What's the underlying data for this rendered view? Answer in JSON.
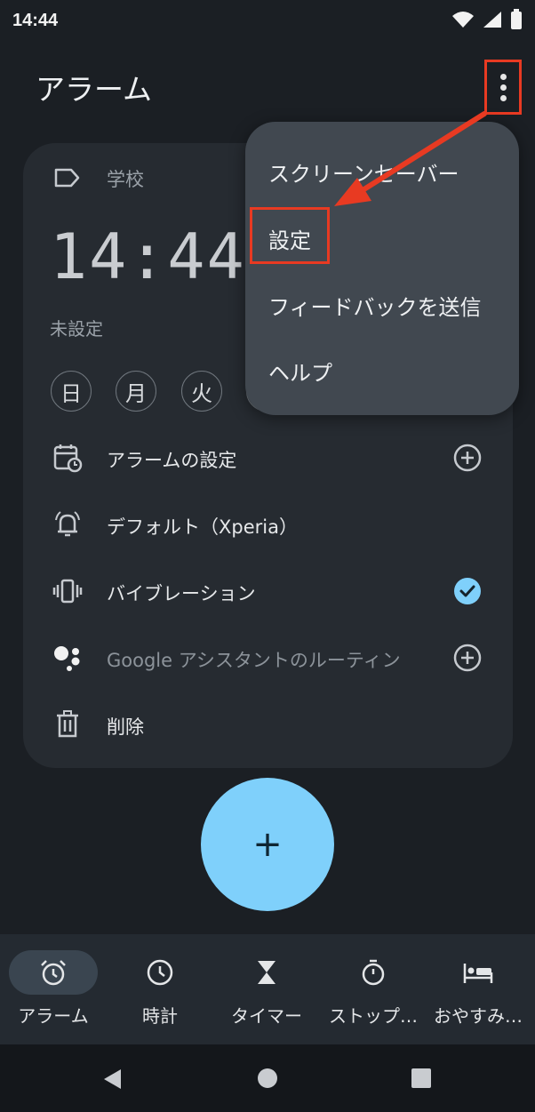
{
  "status_bar": {
    "time": "14:44"
  },
  "app_bar": {
    "title": "アラーム"
  },
  "alarm": {
    "label": "学校",
    "time": "14:44",
    "schedule": "未設定",
    "days": [
      "日",
      "月",
      "火"
    ],
    "rows": {
      "alarm_settings": "アラームの設定",
      "ringtone": "デフォルト（Xperia）",
      "vibration": "バイブレーション",
      "assistant": "Google アシスタントのルーティン",
      "delete": "削除"
    }
  },
  "fab": {
    "symbol": "+"
  },
  "bottom_nav": {
    "items": [
      {
        "label": "アラーム",
        "icon": "alarm-clock-icon",
        "active": true
      },
      {
        "label": "時計",
        "icon": "clock-icon"
      },
      {
        "label": "タイマー",
        "icon": "hourglass-icon"
      },
      {
        "label": "ストップ…",
        "icon": "stopwatch-icon"
      },
      {
        "label": "おやすみ…",
        "icon": "bed-icon"
      }
    ]
  },
  "overflow_menu": {
    "items": [
      "スクリーンセーバー",
      "設定",
      "フィードバックを送信",
      "ヘルプ"
    ]
  },
  "colors": {
    "background": "#1b1f24",
    "card": "#262b31",
    "menu": "#414850",
    "accent": "#7fd0fb",
    "annotation": "#e83a22"
  }
}
